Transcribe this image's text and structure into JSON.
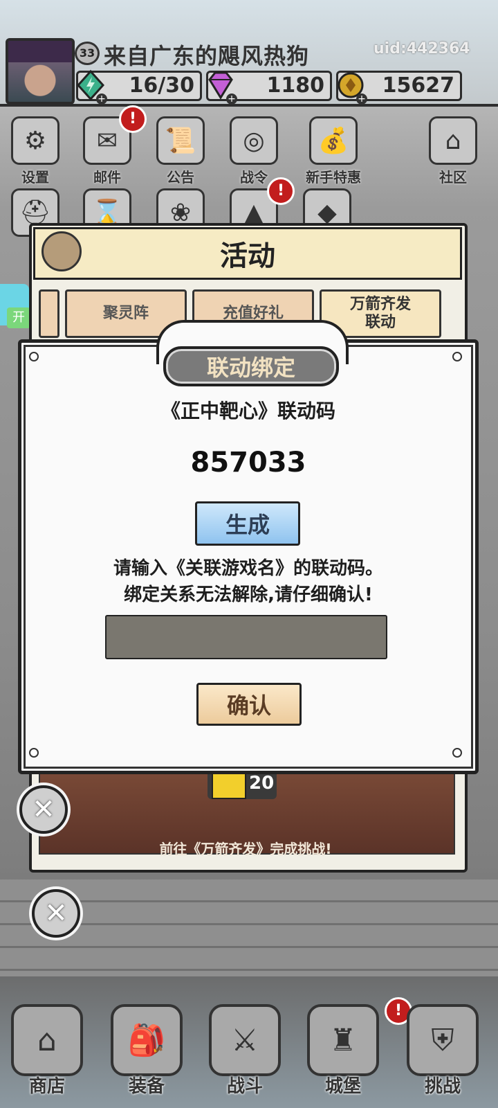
{
  "header": {
    "level": "33",
    "username": "来自广东的飓风热狗",
    "uid": "uid:442364",
    "resources": [
      {
        "icon": "energy-gem-icon",
        "value": "16/30"
      },
      {
        "icon": "diamond-icon",
        "value": "1180"
      },
      {
        "icon": "gold-coin-icon",
        "value": "15627"
      }
    ]
  },
  "menu": {
    "items": [
      {
        "label": "设置",
        "icon": "gear-icon"
      },
      {
        "label": "邮件",
        "icon": "mail-icon",
        "badge": "!"
      },
      {
        "label": "公告",
        "icon": "scroll-icon"
      },
      {
        "label": "战令",
        "icon": "orb-icon"
      },
      {
        "label": "新手特惠",
        "icon": "bag-icon"
      },
      {
        "label": "社区",
        "icon": "home-icon"
      }
    ],
    "row2_badge": "!"
  },
  "side": {
    "open_label": "开"
  },
  "activity": {
    "title": "活动",
    "tabs": [
      "聚灵阵",
      "充值好礼",
      "万箭齐发\n联动"
    ],
    "reward_amount": "20",
    "banner_text": "前往《万箭齐发》完成挑战!"
  },
  "dialog": {
    "title": "联动绑定",
    "code_label": "《正中靶心》联动码",
    "code_value": "857033",
    "generate_label": "生成",
    "hint_line1": "请输入《关联游戏名》的联动码。",
    "hint_line2": "绑定关系无法解除,请仔细确认!",
    "input_value": "",
    "confirm_label": "确认"
  },
  "bottom_nav": {
    "items": [
      {
        "label": "商店",
        "icon": "shop-icon"
      },
      {
        "label": "装备",
        "icon": "backpack-icon"
      },
      {
        "label": "战斗",
        "icon": "crossed-swords-icon"
      },
      {
        "label": "城堡",
        "icon": "castle-icon",
        "badge": "!"
      },
      {
        "label": "挑战",
        "icon": "shield-icon"
      }
    ]
  },
  "colors": {
    "badge_red": "#c21d1d",
    "generate_blue": "#8fc3ef",
    "confirm_tan": "#eccb9c",
    "input_gray": "#7a776f"
  }
}
